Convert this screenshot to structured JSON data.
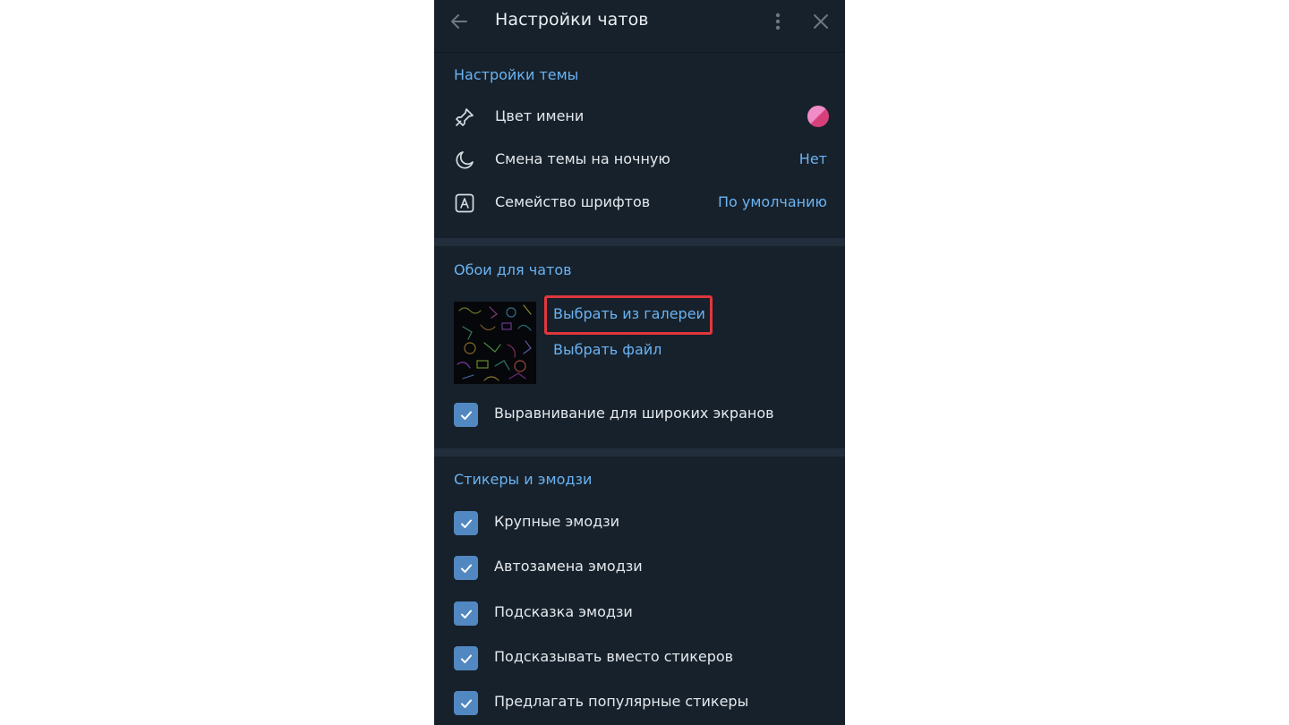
{
  "header": {
    "title": "Настройки чатов",
    "back_icon": "arrow-left-icon",
    "more_icon": "more-vertical-icon",
    "close_icon": "close-icon"
  },
  "theme_section": {
    "title": "Настройки темы",
    "items": [
      {
        "label": "Цвет имени",
        "icon": "brush-icon",
        "value_color": "#e8559a"
      },
      {
        "label": "Смена темы на ночную",
        "icon": "moon-icon",
        "value": "Нет"
      },
      {
        "label": "Семейство шрифтов",
        "icon": "font-icon",
        "value": "По умолчанию"
      }
    ]
  },
  "wallpaper_section": {
    "title": "Обои для чатов",
    "choose_gallery": "Выбрать из галереи",
    "choose_file": "Выбрать файл",
    "wide_screens_label": "Выравнивание для широких экранов",
    "wide_screens_checked": true
  },
  "stickers_section": {
    "title": "Стикеры и эмодзи",
    "options": [
      {
        "label": "Крупные эмодзи",
        "checked": true
      },
      {
        "label": "Автозамена эмодзи",
        "checked": true
      },
      {
        "label": "Подсказка эмодзи",
        "checked": true
      },
      {
        "label": "Подсказывать вместо стикеров",
        "checked": true
      },
      {
        "label": "Предлагать популярные стикеры",
        "checked": true
      }
    ]
  },
  "colors": {
    "panel_bg": "#17212b",
    "accent": "#6ab3f3",
    "checkbox": "#5288c1",
    "highlight": "#e0373d"
  }
}
